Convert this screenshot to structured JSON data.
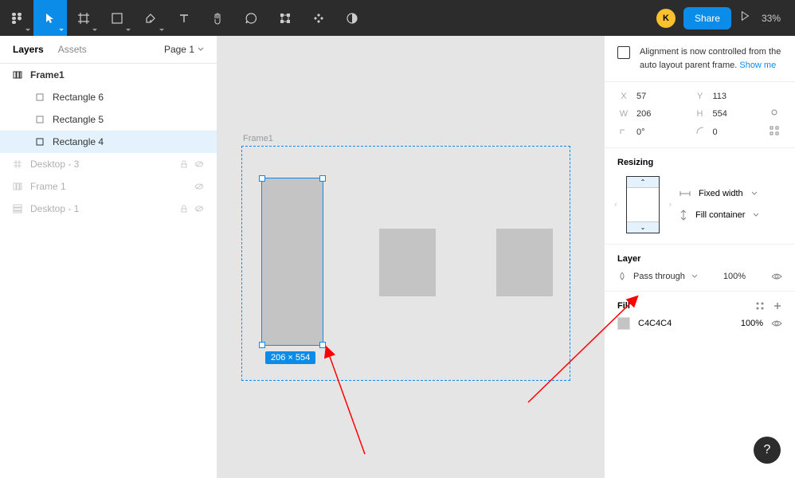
{
  "toolbar": {
    "avatar_initial": "K",
    "share_label": "Share",
    "zoom": "33%"
  },
  "left_panel": {
    "tabs": {
      "layers": "Layers",
      "assets": "Assets"
    },
    "page_selector": "Page 1",
    "layers": [
      {
        "name": "Frame1"
      },
      {
        "name": "Rectangle 6"
      },
      {
        "name": "Rectangle 5"
      },
      {
        "name": "Rectangle 4"
      },
      {
        "name": "Desktop - 3"
      },
      {
        "name": "Frame 1"
      },
      {
        "name": "Desktop - 1"
      }
    ]
  },
  "canvas": {
    "frame_label": "Frame1",
    "selection_dims": "206 × 554"
  },
  "right_panel": {
    "alignment_info": "Alignment is now controlled from the auto layout parent frame. ",
    "alignment_link": "Show me",
    "props": {
      "x": "57",
      "y": "113",
      "w": "206",
      "h": "554",
      "rot": "0°",
      "radius": "0"
    },
    "labels": {
      "x": "X",
      "y": "Y",
      "w": "W",
      "h": "H"
    },
    "resizing": {
      "title": "Resizing",
      "opt1": "Fixed width",
      "opt2": "Fill container"
    },
    "layer": {
      "title": "Layer",
      "blend": "Pass through",
      "opacity": "100%"
    },
    "fill": {
      "title": "Fill",
      "hex": "C4C4C4",
      "opacity": "100%"
    }
  }
}
